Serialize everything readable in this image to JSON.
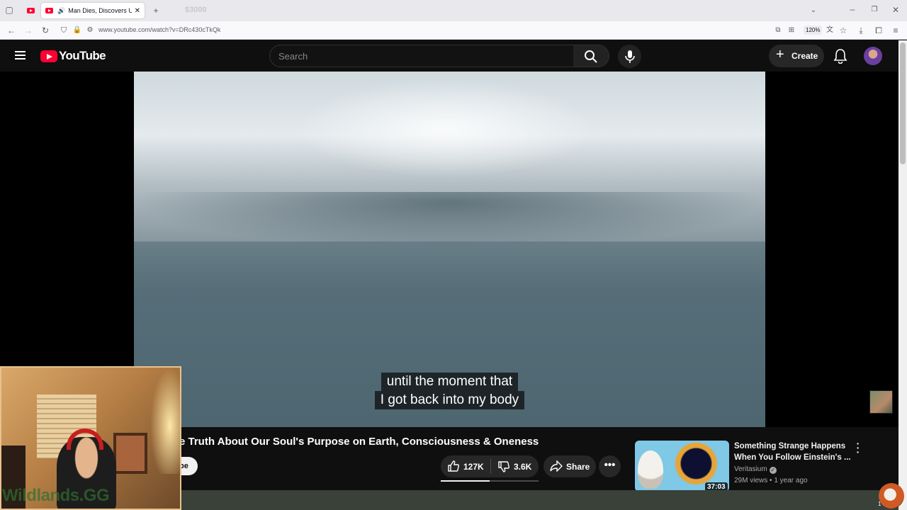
{
  "browser": {
    "tabs": [
      {
        "label": "$3000",
        "active": false
      },
      {
        "label": "Man Dies, Discovers Ultimate",
        "active": true
      }
    ],
    "url": "www.youtube.com/watch?v=DRc430cTkQk",
    "zoom": "120%"
  },
  "youtube": {
    "logo_text": "YouTube",
    "search_placeholder": "Search",
    "create_label": "Create"
  },
  "video": {
    "caption_lines": [
      "until the moment that",
      "I got back into my body"
    ],
    "title": "e Truth About Our Soul's Purpose on Earth, Consciousness & Oneness",
    "subscribe_label": "be",
    "likes": "127K",
    "dislikes": "3.6K",
    "like_ratio": 0.5,
    "share_label": "Share"
  },
  "recommended": {
    "title": "Something Strange Happens When You Follow Einstein's ...",
    "channel": "Veritasium",
    "views": "29M views",
    "age": "1 year ago",
    "duration": "37:03"
  },
  "overlay": {
    "watermark": "Wildlands.GG",
    "corner_count": "1"
  },
  "colors": {
    "youtube_red": "#ff0033",
    "page_background": "#0f0f0f"
  }
}
